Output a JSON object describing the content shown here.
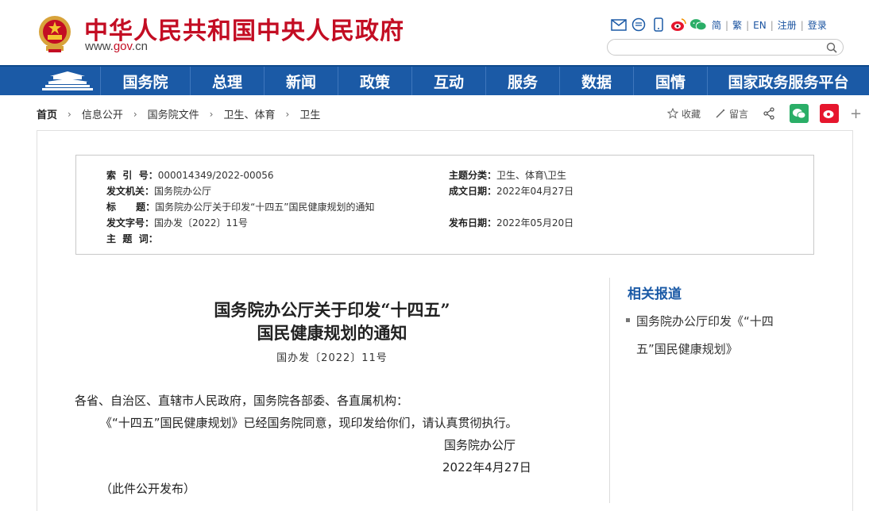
{
  "header": {
    "site_title": "中华人民共和国中央人民政府",
    "url_www": "www.",
    "url_gov": "gov",
    "url_cn": ".cn",
    "lang_links": [
      "简",
      "繁",
      "EN",
      "注册",
      "登录"
    ],
    "search_placeholder": ""
  },
  "nav": {
    "items": [
      "国务院",
      "总理",
      "新闻",
      "政策",
      "互动",
      "服务",
      "数据",
      "国情",
      "国家政务服务平台"
    ]
  },
  "breadcrumb": [
    "首页",
    "信息公开",
    "国务院文件",
    "卫生、体育",
    "卫生"
  ],
  "tools": {
    "favorite": "收藏",
    "comment": "留言",
    "plus": "+"
  },
  "meta": {
    "index_no_label": "索  引  号：",
    "index_no": "000014349/2022-00056",
    "topic_label": "主题分类：",
    "topic": "卫生、体育\\卫生",
    "issuer_label": "发文机关：",
    "issuer": "国务院办公厅",
    "date_label": "成文日期：",
    "date": "2022年04月27日",
    "title_label": "标      题：",
    "title": "国务院办公厅关于印发“十四五”国民健康规划的通知",
    "doc_no_label": "发文字号：",
    "doc_no": "国办发〔2022〕11号",
    "publish_label": "发布日期：",
    "publish": "2022年05月20日",
    "keywords_label": "主  题  词："
  },
  "article": {
    "title_line1": "国务院办公厅关于印发“十四五”",
    "title_line2": "国民健康规划的通知",
    "doc_no": "国办发〔2022〕11号",
    "salutation": "各省、自治区、直辖市人民政府，国务院各部委、各直属机构：",
    "body": "《“十四五”国民健康规划》已经国务院同意，现印发给你们，请认真贯彻执行。",
    "signer": "国务院办公厅",
    "sign_date": "2022年4月27日",
    "note": "（此件公开发布）"
  },
  "related": {
    "title": "相关报道",
    "items": [
      "国务院办公厅印发《“十四",
      "五”国民健康规划》"
    ]
  },
  "colors": {
    "brand_red": "#c30d23",
    "nav_blue": "#1b5aa6",
    "wechat_green": "#2aae67",
    "weibo_red": "#e6162d"
  }
}
